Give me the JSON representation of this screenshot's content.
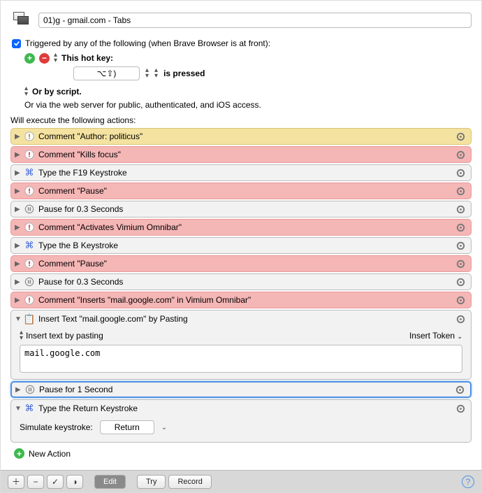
{
  "macroTitle": "01)g - gmail.com - Tabs",
  "triggerLabel": "Triggered by any of the following (when Brave Browser is at front):",
  "hotkeyLabel": "This hot key:",
  "hotkeyBox": "⌥⇧)",
  "hotkeyMode": "is pressed",
  "orScript": "Or by script.",
  "orWeb": "Or via the web server for public, authenticated, and iOS access.",
  "actionsHdr": "Will execute the following actions:",
  "actions": [
    {
      "label": "Comment \"Author: politicus\""
    },
    {
      "label": "Comment \"Kills focus\""
    },
    {
      "label": "Type the F19 Keystroke"
    },
    {
      "label": "Comment \"Pause\""
    },
    {
      "label": "Pause for 0.3 Seconds"
    },
    {
      "label": "Comment \"Activates Vimium Omnibar\""
    },
    {
      "label": "Type the B Keystroke"
    },
    {
      "label": "Comment \"Pause\""
    },
    {
      "label": "Pause for 0.3 Seconds"
    },
    {
      "label": "Comment \"Inserts \"mail.google.com\" in Vimium Omnibar\""
    }
  ],
  "insertText": {
    "title": "Insert Text \"mail.google.com\" by Pasting",
    "subhdr": "Insert text by pasting",
    "insertToken": "Insert Token",
    "value": "mail.google.com"
  },
  "pause1s": "Pause for 1 Second",
  "returnKey": {
    "title": "Type the Return Keystroke",
    "label": "Simulate keystroke:",
    "key": "Return"
  },
  "newAction": "New Action",
  "bottom": {
    "edit": "Edit",
    "try": "Try",
    "record": "Record"
  }
}
